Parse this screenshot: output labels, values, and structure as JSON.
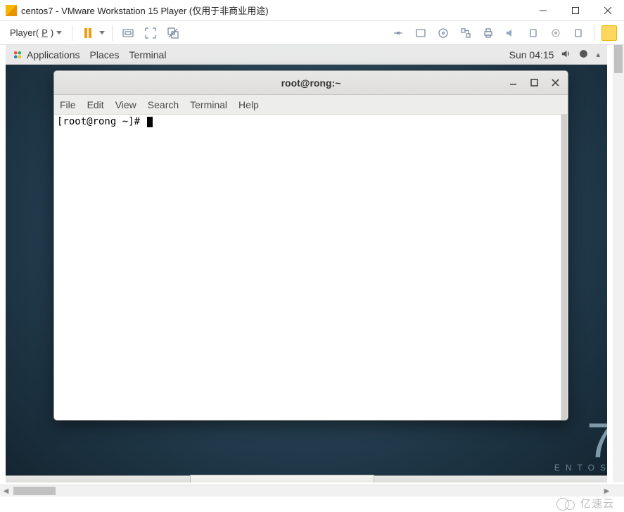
{
  "window": {
    "title": "centos7 - VMware Workstation 15 Player (仅用于非商业用途)"
  },
  "vm_toolbar": {
    "player_label_pre": "Player(",
    "player_label_hot": "P",
    "player_label_post": ")"
  },
  "gnome": {
    "applications": "Applications",
    "places": "Places",
    "terminal": "Terminal",
    "clock": "Sun 04:15"
  },
  "centos": {
    "seven": "7",
    "label": "ENTOS"
  },
  "terminal": {
    "title": "root@rong:~",
    "menus": [
      "File",
      "Edit",
      "View",
      "Search",
      "Terminal",
      "Help"
    ],
    "prompt": "[root@rong ~]# "
  },
  "watermark": "亿速云"
}
